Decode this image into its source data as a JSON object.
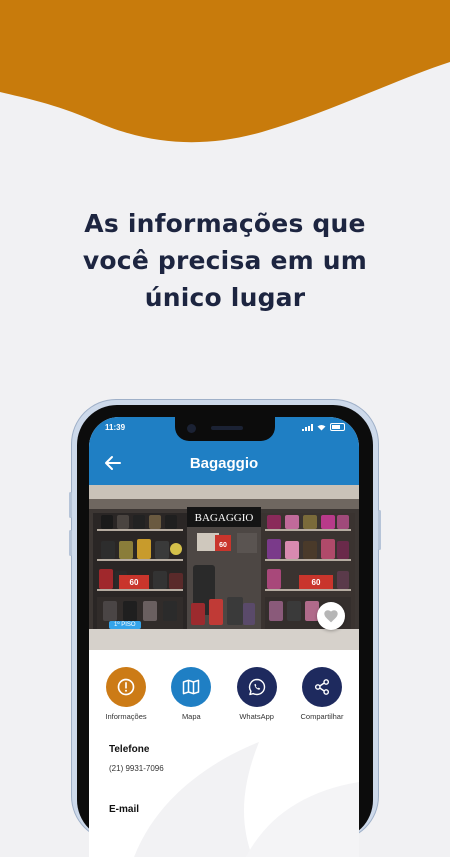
{
  "colors": {
    "wave": "#c87b0c",
    "background": "#f1f1f3",
    "headline": "#1d2540",
    "app_bar": "#1f7fc4",
    "action_info": "#cc7b16",
    "action_map": "#1f7fc4",
    "action_dark": "#1e2a5e"
  },
  "headline": {
    "line1": "As informações que",
    "line2": "você precisa em um",
    "line3": "único lugar"
  },
  "status_bar": {
    "time": "11:39"
  },
  "app_bar": {
    "title": "Bagaggio"
  },
  "photo": {
    "store_sign": "BAGAGGIO",
    "floor_badge": "1º PISO",
    "sale_tag_center": "60",
    "sale_tag_left": "60",
    "sale_tag_right": "60"
  },
  "actions": [
    {
      "label": "Informações",
      "icon": "info-icon"
    },
    {
      "label": "Mapa",
      "icon": "map-icon"
    },
    {
      "label": "WhatsApp",
      "icon": "whatsapp-icon"
    },
    {
      "label": "Compartilhar",
      "icon": "share-icon"
    }
  ],
  "details": {
    "phone_label": "Telefone",
    "phone_value": "(21) 9931-7096",
    "next_label": "E-mail"
  }
}
